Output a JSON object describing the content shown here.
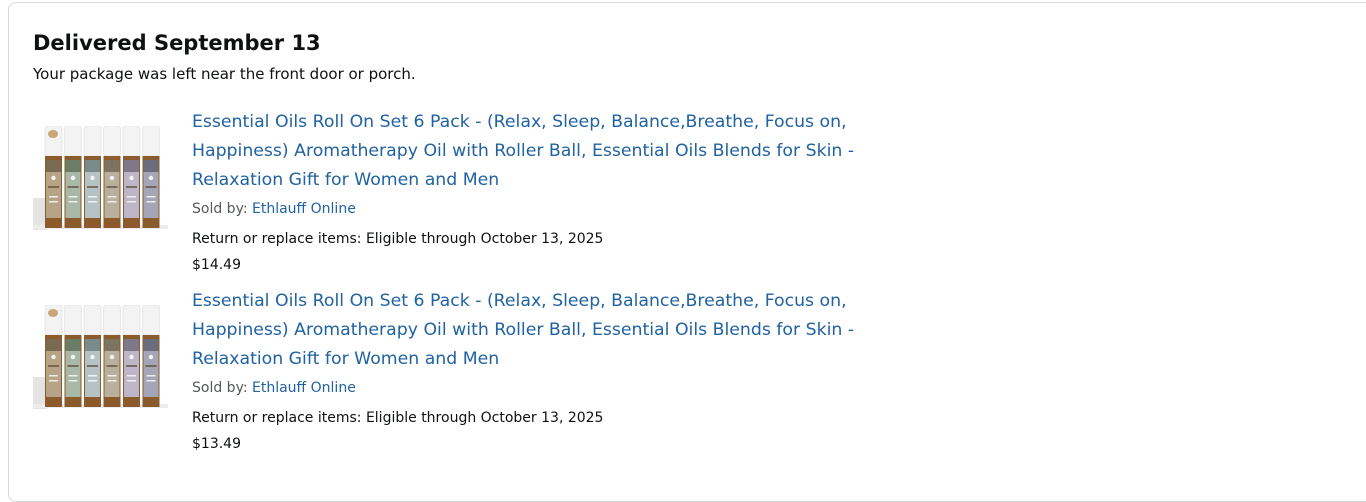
{
  "delivery": {
    "status": "Delivered September 13",
    "note": "Your package was left near the front door or porch."
  },
  "items": [
    {
      "title": "Essential Oils Roll On Set 6 Pack - (Relax, Sleep, Balance,Breathe, Focus on, Happiness) Aromatherapy Oil with Roller Ball, Essential Oils Blends for Skin - Relaxation Gift for Women and Men",
      "sold_by_label": "Sold by: ",
      "seller": "Ethlauff Online",
      "return_text": "Return or replace items: Eligible through October 13, 2025",
      "price": "$14.49"
    },
    {
      "title": "Essential Oils Roll On Set 6 Pack - (Relax, Sleep, Balance,Breathe, Focus on, Happiness) Aromatherapy Oil with Roller Ball, Essential Oils Blends for Skin - Relaxation Gift for Women and Men",
      "sold_by_label": "Sold by: ",
      "seller": "Ethlauff Online",
      "return_text": "Return or replace items: Eligible through October 13, 2025",
      "price": "$13.49"
    }
  ],
  "product_image": {
    "icon": "essential-oil-bottles-image",
    "label_colors": [
      "#b7a488",
      "#a9b9a7",
      "#b6c3c4",
      "#b8b09c",
      "#bcb6c8",
      "#a3a6b6"
    ],
    "band_colors": [
      "#7a6a52",
      "#6a7d67",
      "#7a8b8c",
      "#7c7460",
      "#7f7889",
      "#6b6d7d"
    ],
    "cap_color": "#8a5a2b"
  }
}
